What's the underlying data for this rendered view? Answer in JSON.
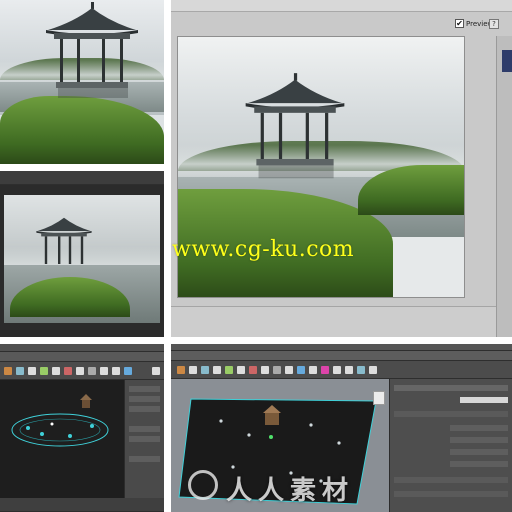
{
  "watermark": {
    "site": "www.cg-ku.com",
    "chinese": "人人素材"
  },
  "dialog": {
    "preview_label": "Preview",
    "preview_checked": "✔",
    "help_label": "?"
  },
  "colors": {
    "watermark_yellow": "#ffff1a",
    "grass_green": "#4f7f2c",
    "maya_bg": "#3a3a3a",
    "selection_cyan": "#3fd0d8"
  },
  "icons": [
    "pavilion-image",
    "checkbox-icon",
    "help-icon",
    "logo-icon"
  ]
}
